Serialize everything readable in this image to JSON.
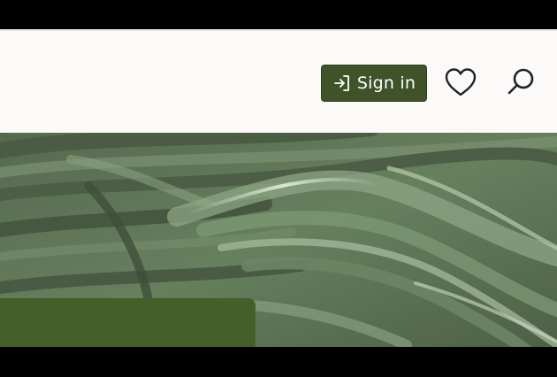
{
  "header": {
    "signin_label": "Sign in",
    "signin_icon": "sign-in-arrow-icon",
    "wishlist_icon": "heart-icon",
    "search_icon": "search-icon"
  },
  "hero": {
    "image": "green-leaves-closeup"
  },
  "colors": {
    "header_bg": "#fcf9f9",
    "brand_green": "#3f5228",
    "cta_green": "#445f27",
    "hero_base": "#5d7158"
  }
}
